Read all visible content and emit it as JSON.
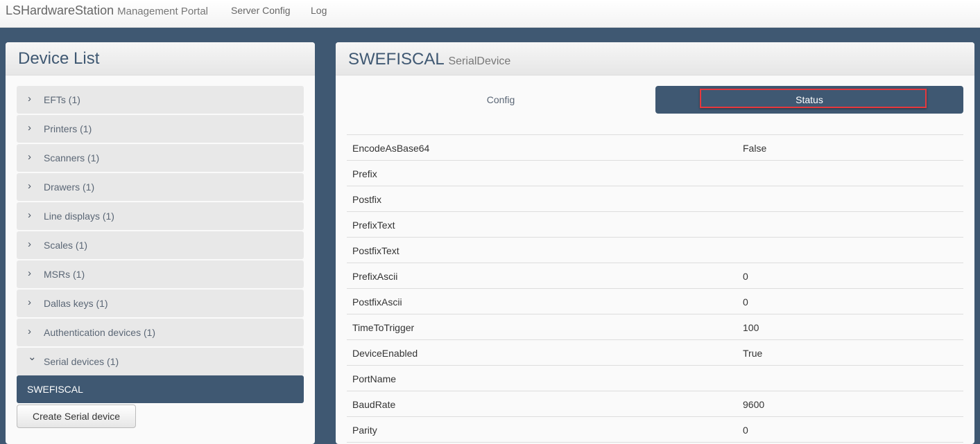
{
  "nav": {
    "brand": "LSHardwareStation",
    "brand_sub": "Management Portal",
    "links": [
      "Server Config",
      "Log"
    ]
  },
  "device_list": {
    "title": "Device List",
    "groups": [
      "EFTs (1)",
      "Printers (1)",
      "Scanners (1)",
      "Drawers (1)",
      "Line displays (1)",
      "Scales (1)",
      "MSRs (1)",
      "Dallas keys (1)",
      "Authentication devices (1)",
      "Serial devices (1)"
    ],
    "selected": "SWEFISCAL",
    "create_button": "Create Serial device"
  },
  "detail": {
    "title": "SWEFISCAL",
    "subtitle": "SerialDevice",
    "tabs": [
      "Config",
      "Status"
    ],
    "active_tab": "Status",
    "rows": [
      [
        "EncodeAsBase64",
        "False"
      ],
      [
        "Prefix",
        ""
      ],
      [
        "Postfix",
        ""
      ],
      [
        "PrefixText",
        ""
      ],
      [
        "PostfixText",
        ""
      ],
      [
        "PrefixAscii",
        "0"
      ],
      [
        "PostfixAscii",
        "0"
      ],
      [
        "TimeToTrigger",
        "100"
      ],
      [
        "DeviceEnabled",
        "True"
      ],
      [
        "PortName",
        ""
      ],
      [
        "BaudRate",
        "9600"
      ],
      [
        "Parity",
        "0"
      ]
    ]
  }
}
